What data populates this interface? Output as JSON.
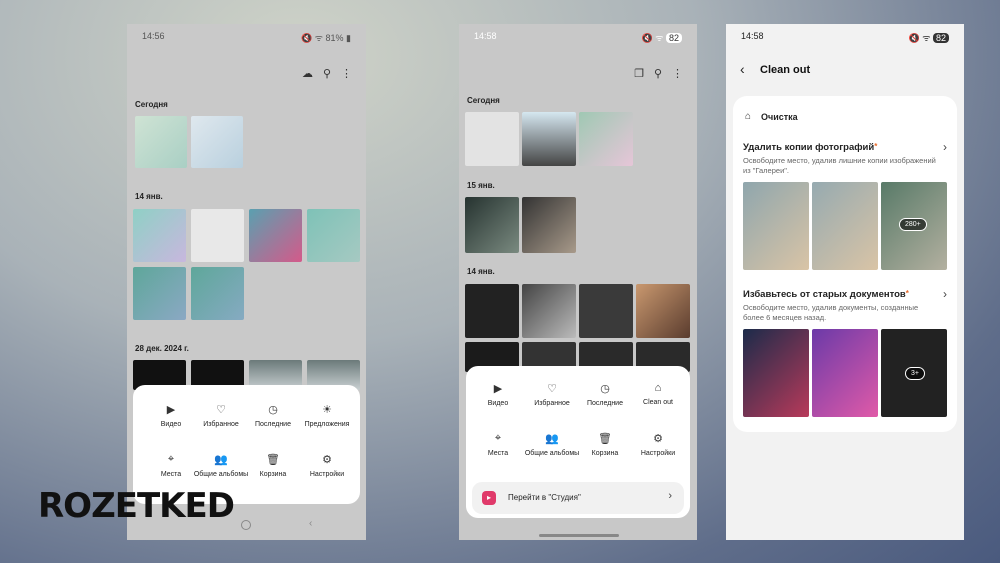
{
  "phone1": {
    "status": {
      "time": "14:56",
      "battery": "81%"
    },
    "sections": [
      "Сегодня",
      "14 янв.",
      "28 дек. 2024 г."
    ],
    "menu": [
      "Видео",
      "Избранное",
      "Последние",
      "Предложения",
      "Места",
      "Общие альбомы",
      "Корзина",
      "Настройки"
    ]
  },
  "phone2": {
    "status": {
      "time": "14:58",
      "battery": "82"
    },
    "sections": [
      "Сегодня",
      "15 янв.",
      "14 янв."
    ],
    "menu": [
      "Видео",
      "Избранное",
      "Последние",
      "Clean out",
      "Места",
      "Общие альбомы",
      "Корзина",
      "Настройки"
    ],
    "studio_label": "Перейти в \"Студия\""
  },
  "phone3": {
    "status": {
      "time": "14:58",
      "battery": "82"
    },
    "title": "Clean out",
    "section": "Очистка",
    "items": [
      {
        "title": "Удалить копии фотографий",
        "desc": "Освободите место, удалив лишние копии изображений из \"Галереи\".",
        "badge": "280+"
      },
      {
        "title": "Избавьтесь от старых документов",
        "desc": "Освободите место, удалив документы, созданные более 6 месяцев назад.",
        "badge": "3+"
      }
    ]
  },
  "watermark": "ROZETKED",
  "icons": {
    "video": "video-icon",
    "favorite": "heart-icon",
    "recent": "clock-icon",
    "suggest": "bulb-icon",
    "places": "pin-icon",
    "shared": "people-icon",
    "trash": "trash-icon",
    "settings": "gear-icon"
  }
}
